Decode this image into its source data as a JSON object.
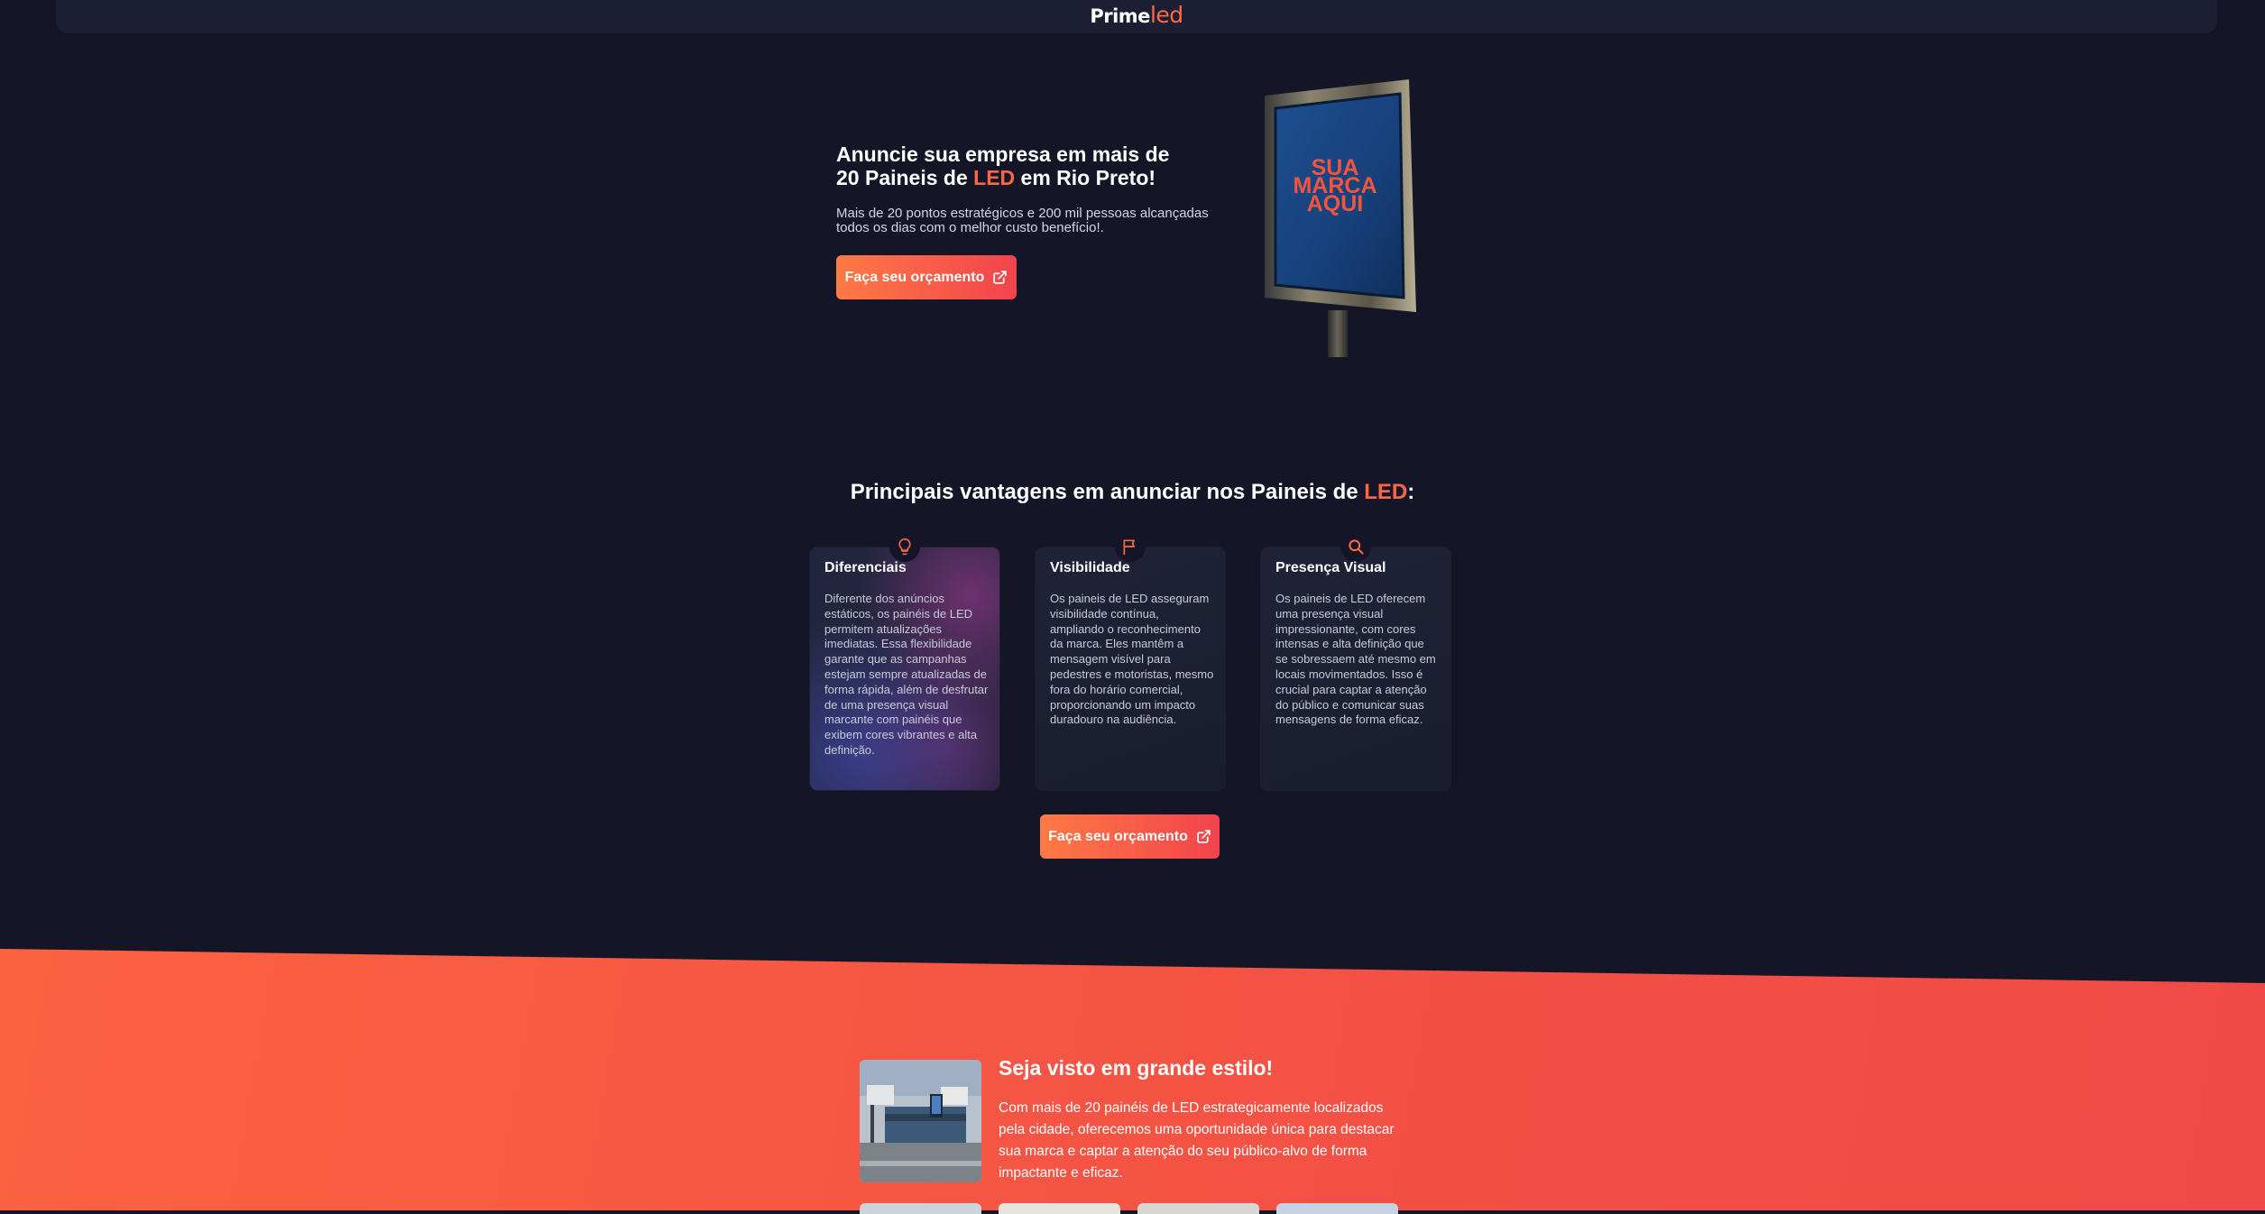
{
  "header": {
    "logo_prime": "Prime",
    "logo_led": "led"
  },
  "hero": {
    "title_part1": "Anuncie sua empresa em mais de 20 Paineis de ",
    "title_accent": "LED",
    "title_part2": " em Rio Preto!",
    "subtitle": "Mais de 20 pontos estratégicos e 200 mil pessoas alcançadas todos os dias com o melhor custo benefício!.",
    "cta_label": "Faça seu orçamento",
    "billboard_line1": "SUA",
    "billboard_line2": "MARCA",
    "billboard_line3": "AQUI"
  },
  "advantages": {
    "title_part1": "Principais vantagens em anunciar nos Paineis de ",
    "title_accent": "LED",
    "title_part2": ":",
    "cards": [
      {
        "icon": "lightbulb-icon",
        "title": "Diferenciais",
        "text": "Diferente dos anúncios estáticos, os painéis de LED permitem atualizações imediatas. Essa flexibilidade garante que as campanhas estejam sempre atualizadas de forma rápida, além de desfrutar de uma presença visual marcante com painéis que exibem cores vibrantes e alta definição."
      },
      {
        "icon": "flag-icon",
        "title": "Visibilidade",
        "text": "Os paineis de LED asseguram visibilidade contínua, ampliando o reconhecimento da marca. Eles mantêm a mensagem visível para pedestres e motoristas, mesmo fora do horário comercial, proporcionando um impacto duradouro na audiência."
      },
      {
        "icon": "search-icon",
        "title": "Presença Visual",
        "text": "Os paineis de LED oferecem uma presença visual impressionante, com cores intensas e alta definição que se sobressaem até mesmo em locais movimentados. Isso é crucial para captar a atenção do público e comunicar suas mensagens de forma eficaz."
      }
    ],
    "cta_label": "Faça seu orçamento"
  },
  "showcase": {
    "title": "Seja visto em grande estilo!",
    "text": "Com mais de 20 painéis de LED estrategicamente localizados pela cidade, oferecemos uma oportunidade única para destacar sua marca e captar a atenção do seu público-alvo de forma impactante e eficaz."
  },
  "colors": {
    "accent": "#ff6744",
    "background": "#141628",
    "card": "#1e2135",
    "band": "#f55344"
  }
}
